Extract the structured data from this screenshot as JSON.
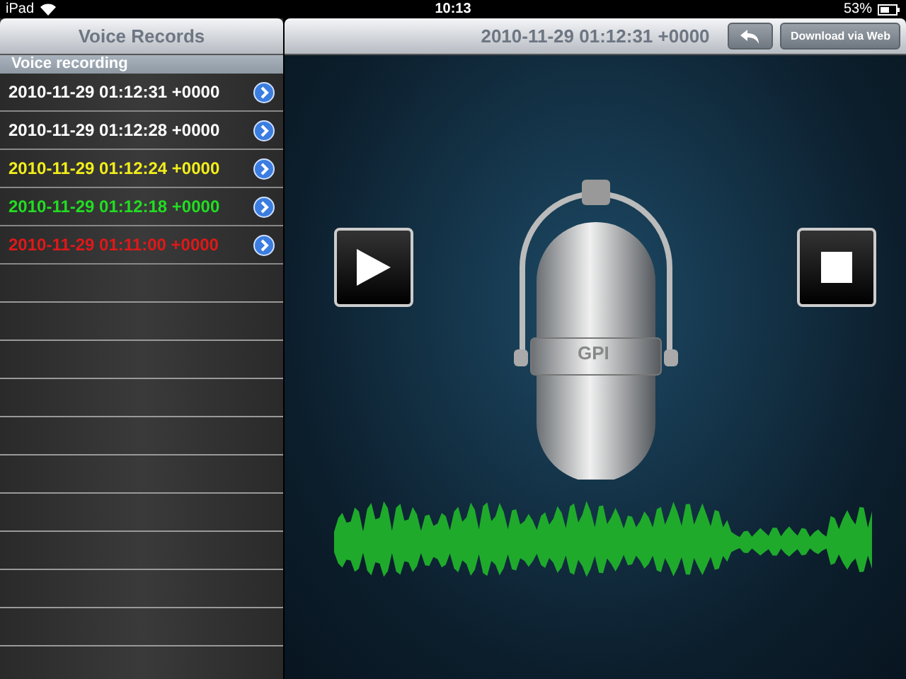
{
  "status_bar": {
    "device": "iPad",
    "time": "10:13",
    "battery": "53%"
  },
  "sidebar": {
    "title": "Voice Records",
    "section": "Voice recording",
    "items": [
      {
        "label": "2010-11-29 01:12:31 +0000",
        "color": "#ffffff"
      },
      {
        "label": "2010-11-29 01:12:28 +0000",
        "color": "#ffffff"
      },
      {
        "label": "2010-11-29 01:12:24 +0000",
        "color": "#f2ee1a"
      },
      {
        "label": "2010-11-29 01:12:18 +0000",
        "color": "#22dd22"
      },
      {
        "label": "2010-11-29 01:11:00 +0000",
        "color": "#e01818"
      }
    ]
  },
  "detail": {
    "title": "2010-11-29 01:12:31 +0000",
    "download_button": "Download via Web",
    "mic_label": "GPI"
  }
}
